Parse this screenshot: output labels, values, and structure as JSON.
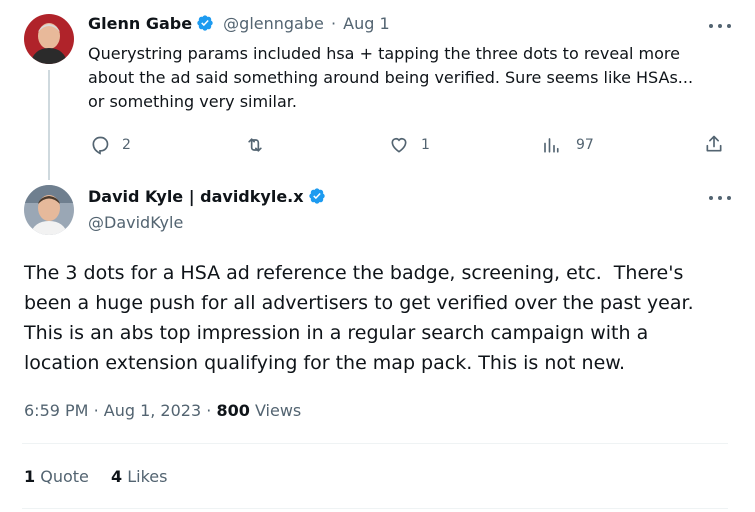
{
  "reply": {
    "author_name": "Glenn Gabe",
    "author_handle": "@glenngabe",
    "separator": "·",
    "date": "Aug 1",
    "text_line1": "Querystring params included hsa + tapping the three dots to reveal more",
    "text_line2": "about the ad said something around being verified. Sure seems like HSAs...",
    "text_line3": "or something very similar.",
    "actions": {
      "replies": "2",
      "retweets": "",
      "likes": "1",
      "views": "97"
    }
  },
  "tweet": {
    "author_name": "David Kyle | davidkyle.x",
    "author_handle": "@DavidKyle",
    "text_line1": "The 3 dots for a HSA ad reference the badge, screening, etc.  There's",
    "text_line2": "been a huge push for all advertisers to get verified over the past year.",
    "text_line3": "This is an abs top impression in a regular search campaign with a",
    "text_line4": "location extension qualifying for the map pack. This is not new.",
    "time": "6:59 PM",
    "date": "Aug 1, 2023",
    "separator": "·",
    "views_count": "800",
    "views_label": "Views",
    "stats": {
      "quotes_count": "1",
      "quotes_label": "Quote",
      "likes_count": "4",
      "likes_label": "Likes"
    }
  },
  "colors": {
    "verified": "#1d9bf0",
    "text": "#0f1419",
    "secondary": "#536471",
    "divider": "#eff3f4"
  }
}
